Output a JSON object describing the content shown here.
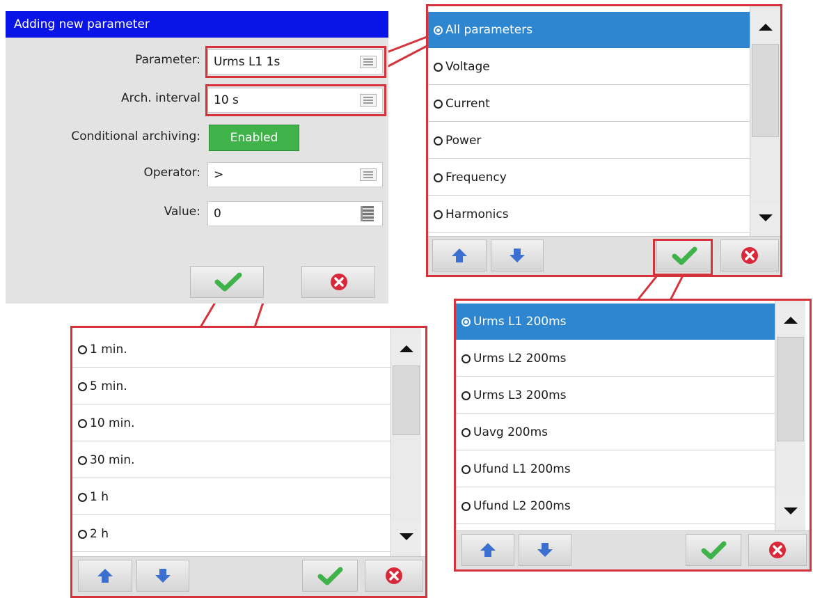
{
  "dialog": {
    "title": "Adding new parameter",
    "fields": {
      "parameter": {
        "label": "Parameter:",
        "value": "Urms L1 1s"
      },
      "arch_interval": {
        "label": "Arch. interval",
        "value": "10 s"
      },
      "conditional_archiving": {
        "label": "Conditional archiving:",
        "value": "Enabled"
      },
      "operator": {
        "label": "Operator:",
        "value": ">"
      },
      "value": {
        "label": "Value:",
        "value": "0"
      }
    },
    "buttons": {
      "ok_icon": "checkmark-icon",
      "cancel_icon": "cancel-icon"
    }
  },
  "category_popup": {
    "selected": "All parameters",
    "items": [
      "All parameters",
      "Voltage",
      "Current",
      "Power",
      "Frequency",
      "Harmonics"
    ]
  },
  "interval_popup": {
    "items": [
      "1 min.",
      "5 min.",
      "10 min.",
      "30 min.",
      "1 h",
      "2 h"
    ]
  },
  "parameter_popup": {
    "selected": "Urms L1 200ms",
    "items": [
      "Urms L1 200ms",
      "Urms L2 200ms",
      "Urms L3 200ms",
      "Uavg 200ms",
      "Ufund L1 200ms",
      "Ufund L2 200ms"
    ]
  },
  "colors": {
    "title_bar": "#0a14e6",
    "selection": "#2f86d0",
    "toggle_enabled": "#3fb24a",
    "highlight_frame": "#d5323c"
  }
}
